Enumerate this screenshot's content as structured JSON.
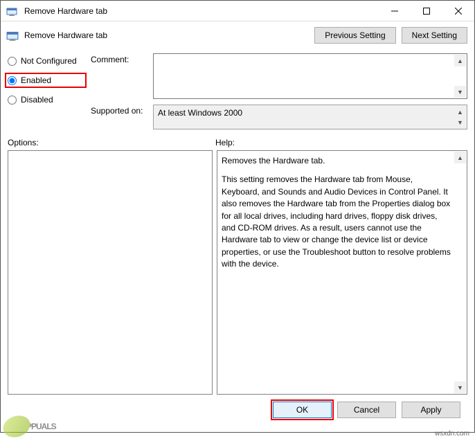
{
  "titlebar": {
    "title": "Remove Hardware tab"
  },
  "header": {
    "title": "Remove Hardware tab",
    "prev_btn": "Previous Setting",
    "next_btn": "Next Setting"
  },
  "radios": {
    "not_configured": "Not Configured",
    "enabled": "Enabled",
    "disabled": "Disabled",
    "selected": "enabled"
  },
  "fields": {
    "comment_label": "Comment:",
    "comment_value": "",
    "supported_label": "Supported on:",
    "supported_value": "At least Windows 2000"
  },
  "sections": {
    "options_label": "Options:",
    "help_label": "Help:"
  },
  "help": {
    "p1": "Removes the Hardware tab.",
    "p2": "This setting removes the Hardware tab from Mouse, Keyboard, and Sounds and Audio Devices in Control Panel. It also removes the Hardware tab from the Properties dialog box for all local drives, including hard drives, floppy disk drives, and CD-ROM drives. As a result, users cannot use the Hardware tab to view or change the device list or device properties, or use the Troubleshoot button to resolve problems with the device."
  },
  "footer": {
    "ok": "OK",
    "cancel": "Cancel",
    "apply": "Apply"
  },
  "watermark": {
    "text": "PPUALS",
    "credit": "wsxdn.com"
  }
}
